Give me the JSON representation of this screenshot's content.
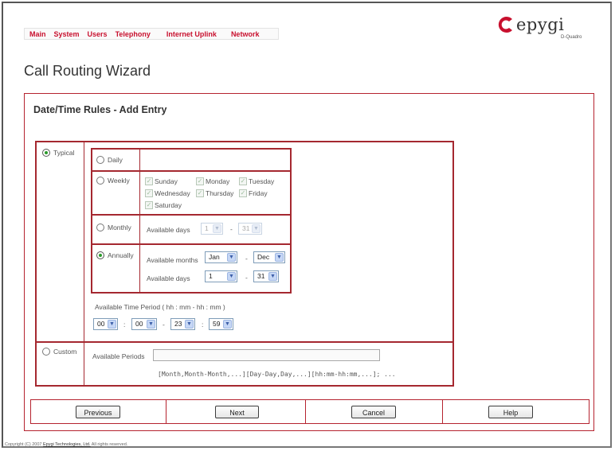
{
  "nav": {
    "items": [
      "Main",
      "System",
      "Users",
      "Telephony",
      "Internet Uplink",
      "Network"
    ]
  },
  "logo": {
    "word": "epygi",
    "subtitle": "D-Quadro"
  },
  "page_title": "Call Routing Wizard",
  "section_title": "Date/Time Rules - Add Entry",
  "typical": {
    "label": "Typical",
    "daily_label": "Daily",
    "weekly_label": "Weekly",
    "days": {
      "sunday": "Sunday",
      "monday": "Monday",
      "tuesday": "Tuesday",
      "wednesday": "Wednesday",
      "thursday": "Thursday",
      "friday": "Friday",
      "saturday": "Saturday"
    },
    "monthly": {
      "label": "Monthly",
      "available_days_label": "Available days",
      "from": "1",
      "dash": "-",
      "to": "31"
    },
    "annually": {
      "label": "Annually",
      "months_label": "Available months",
      "month_from": "Jan",
      "month_to": "Dec",
      "days_label": "Available days",
      "day_from": "1",
      "day_to": "31",
      "dash": "-"
    },
    "time_period": {
      "label": "Available Time Period ( hh : mm - hh : mm )",
      "from_hh": "00",
      "from_mm": "00",
      "to_hh": "23",
      "to_mm": "59",
      "colon": ":",
      "dash": "-"
    }
  },
  "custom": {
    "label": "Custom",
    "periods_label": "Available Periods",
    "value": "",
    "hint": "[Month,Month-Month,...][Day-Day,Day,...][hh:mm-hh:mm,...]; ..."
  },
  "buttons": {
    "previous": "Previous",
    "next": "Next",
    "cancel": "Cancel",
    "help": "Help"
  },
  "footer": {
    "prefix": "Copyright (C) 2007",
    "link": "Epygi Technologies, Ltd.",
    "suffix": "All rights reserved."
  },
  "colors": {
    "accent": "#c8102e",
    "border": "#a52830",
    "radio_on": "#2a9a2a"
  }
}
